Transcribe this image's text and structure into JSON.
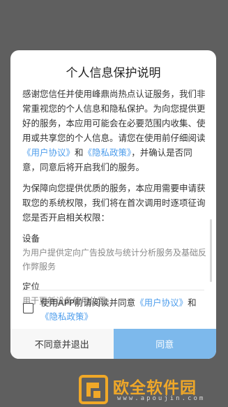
{
  "dialog": {
    "title": "个人信息保护说明",
    "para1_text_a": "感谢您信任并使用峰鼎尚热点认证服务，我们非常重视您的个人信息和隐私保护。为向您提供更好的服务，本应用可能会在必要范围内收集、使用或共享您的个人信息。请您在使用前仔细阅读",
    "user_agreement_link": "《用户协议》",
    "para1_and": "和",
    "privacy_policy_link": "《隐私政策》",
    "para1_text_b": "，并确认是否同意，同意后将开启我们的服务。",
    "para2": "为保障向您提供优质的服务，本应用需要申请获取您的系统权限，我们将在首次调用时逐项征询您是否开启相关权限：",
    "permissions": [
      {
        "name": "设备",
        "desc": "为用户提供定向广告投放与统计分析服务及基础反作弊服务"
      },
      {
        "name": "定位",
        "desc": "用于更新设备使用位置"
      }
    ],
    "consent_text_a": "使用APP前请阅读并同意",
    "consent_user_link": "《用户协议》",
    "consent_and": "和",
    "consent_privacy_link": "《隐私政策》",
    "cancel_label": "不同意并退出",
    "agree_label": "同意"
  },
  "watermark": {
    "title": "欧全软件园",
    "url": "www.apoujin.com"
  },
  "colors": {
    "link": "#4d9dec",
    "agree_button": "#7db9ec",
    "overlay": "#5f5f5f",
    "watermark": "#f0a828"
  }
}
